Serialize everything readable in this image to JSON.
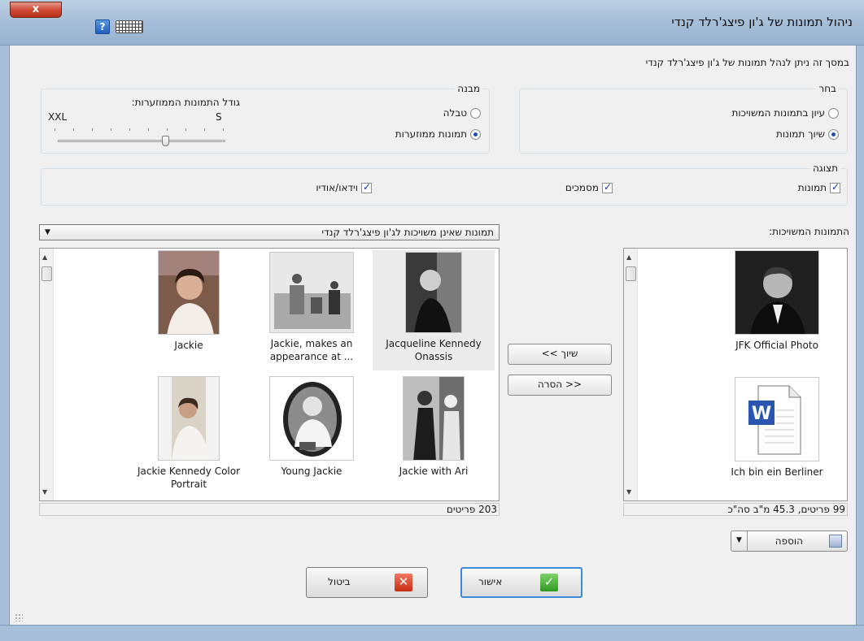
{
  "window": {
    "title": "ניהול תמונות של ג'ון פיצג'רלד קנדי",
    "close_label": "x",
    "help_label": "?"
  },
  "description": "במסך זה ניתן לנהל תמונות של ג'ון פיצג'רלד קנדי",
  "select_group": {
    "legend": "בחר",
    "options": [
      "עיון בתמונות המשויכות",
      "שיוך תמונות"
    ],
    "selected_index": 1
  },
  "structure_group": {
    "legend": "מבנה",
    "options": [
      "טבלה",
      "תמונות ממוזערות"
    ],
    "selected_index": 1
  },
  "thumb_size": {
    "label": "גודל התמונות הממוזערות:",
    "min_label": "S",
    "max_label": "XXL"
  },
  "display_group": {
    "legend": "תצוגה",
    "options": [
      {
        "label": "תמונות",
        "checked": true
      },
      {
        "label": "מסמכים",
        "checked": true
      },
      {
        "label": "וידאו/אודיו",
        "checked": true
      }
    ]
  },
  "associated": {
    "heading": "התמונות המשויכות:",
    "items": [
      "JFK Official Photo",
      "Ich bin ein Berliner"
    ],
    "status": "99 פריטים, 45.3 מ\"ב סה\"כ"
  },
  "unassociated": {
    "filter_value": "תמונות שאינן משויכות לג'ון פיצג'רלד קנדי",
    "items": [
      {
        "caption": "Jacqueline Kennedy Onassis",
        "icon": "portrait-photo-icon"
      },
      {
        "caption": "Jackie, makes an appearance at ...",
        "icon": "event-photo-icon"
      },
      {
        "caption": "Jackie",
        "icon": "portrait-photo-icon"
      },
      {
        "caption": "Jackie with Ari",
        "icon": "portrait-photo-icon"
      },
      {
        "caption": "Young Jackie",
        "icon": "portrait-photo-icon"
      },
      {
        "caption": "Jackie Kennedy Color Portrait",
        "icon": "portrait-photo-icon"
      }
    ],
    "status": "203 פריטים"
  },
  "transfer": {
    "assign_label": "<< שיוך",
    "remove_label": "הסרה >>"
  },
  "add_button": {
    "label": "הוספה"
  },
  "footer": {
    "ok_label": "אישור",
    "cancel_label": "ביטול"
  }
}
